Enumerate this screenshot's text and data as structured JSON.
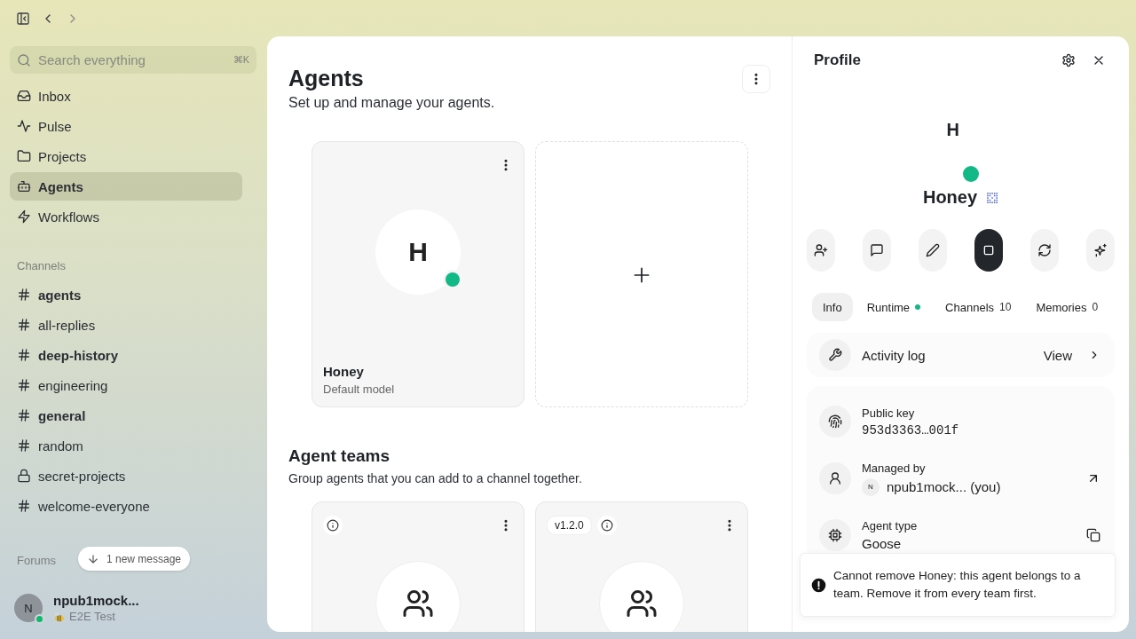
{
  "sidebar": {
    "search": {
      "placeholder": "Search everything",
      "shortcut": "⌘K"
    },
    "nav": [
      {
        "label": "Inbox",
        "selected": false
      },
      {
        "label": "Pulse",
        "selected": false
      },
      {
        "label": "Projects",
        "selected": false
      },
      {
        "label": "Agents",
        "selected": true
      },
      {
        "label": "Workflows",
        "selected": false
      }
    ],
    "channels_heading": "Channels",
    "channels": [
      {
        "name": "agents",
        "kind": "public",
        "unread": true
      },
      {
        "name": "all-replies",
        "kind": "public",
        "unread": false
      },
      {
        "name": "deep-history",
        "kind": "public",
        "unread": true
      },
      {
        "name": "engineering",
        "kind": "public",
        "unread": false
      },
      {
        "name": "general",
        "kind": "public",
        "unread": true
      },
      {
        "name": "random",
        "kind": "public",
        "unread": false
      },
      {
        "name": "secret-projects",
        "kind": "private",
        "unread": false
      },
      {
        "name": "welcome-everyone",
        "kind": "public",
        "unread": false
      }
    ],
    "forums_heading": "Forums",
    "new_message": "1 new message",
    "user": {
      "initial": "N",
      "name": "npub1mock...",
      "status": "E2E Test",
      "online": true
    }
  },
  "agents": {
    "title": "Agents",
    "subtitle": "Set up and manage your agents.",
    "cards": [
      {
        "initial": "H",
        "name": "Honey",
        "model": "Default model",
        "online": true
      }
    ]
  },
  "teams": {
    "title": "Agent teams",
    "subtitle": "Group agents that you can add to a channel together.",
    "cards": [
      {
        "info_icon": true
      },
      {
        "version": "v1.2.0",
        "info_icon": true
      }
    ]
  },
  "profile": {
    "title": "Profile",
    "initial": "H",
    "name": "Honey",
    "online": true,
    "actions": [
      {
        "selected": false
      },
      {
        "selected": false
      },
      {
        "selected": false
      },
      {
        "selected": true
      },
      {
        "selected": false
      },
      {
        "selected": false
      }
    ],
    "tabs": [
      {
        "label": "Info",
        "selected": true
      },
      {
        "label": "Runtime",
        "selected": false,
        "online": true
      },
      {
        "label": "Channels",
        "selected": false,
        "count": "10"
      },
      {
        "label": "Memories",
        "selected": false,
        "count": "0"
      }
    ],
    "activity": {
      "label": "Activity log",
      "action": "View"
    },
    "details": [
      {
        "label": "Public key",
        "value": "953d3363…001f",
        "kind": "mono"
      },
      {
        "label": "Managed by",
        "value": "npub1mock... (you)",
        "kind": "person",
        "initial": "N"
      },
      {
        "label": "Agent type",
        "value": "Goose",
        "kind": "plain"
      }
    ],
    "toast": "Cannot remove Honey: this agent belongs to a team. Remove it from every team first."
  }
}
